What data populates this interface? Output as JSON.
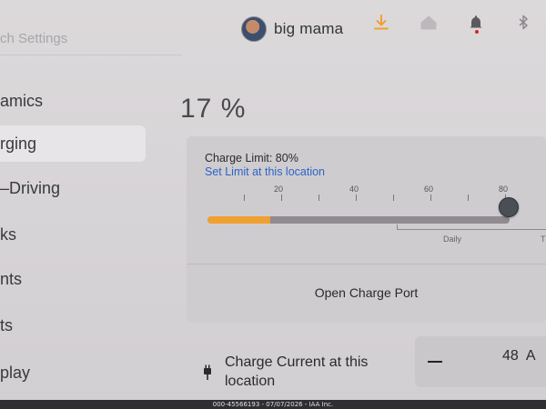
{
  "header": {
    "search_placeholder": "ch Settings",
    "profile_name": "big mama",
    "icons": [
      "download-icon",
      "home-icon",
      "bell-icon",
      "bluetooth-icon"
    ],
    "accent_color": "#f0a030",
    "notification_color": "#e02020"
  },
  "sidebar": {
    "items": [
      {
        "label": "amics",
        "active": false
      },
      {
        "label": "rging",
        "active": true
      },
      {
        "label": "–Driving",
        "active": false
      },
      {
        "label": "ks",
        "active": false
      },
      {
        "label": "nts",
        "active": false
      },
      {
        "label": "ts",
        "active": false
      },
      {
        "label": "play",
        "active": false
      }
    ]
  },
  "charging": {
    "battery_percent_text": "17 %",
    "battery_level": 0.17,
    "charge_limit_text": "Charge Limit: 80%",
    "charge_limit_value": 80,
    "set_limit_link": "Set Limit at this location",
    "scale_labels": [
      "20",
      "40",
      "60",
      "80"
    ],
    "daily_label": "Daily",
    "trip_label_partial": "T",
    "open_port_label": "Open Charge Port",
    "charge_current_label": "Charge Current at this location",
    "current_value": "48",
    "current_unit": "A"
  },
  "footer": {
    "watermark": "000-45566193 - 07/07/2026 - IAA Inc."
  }
}
